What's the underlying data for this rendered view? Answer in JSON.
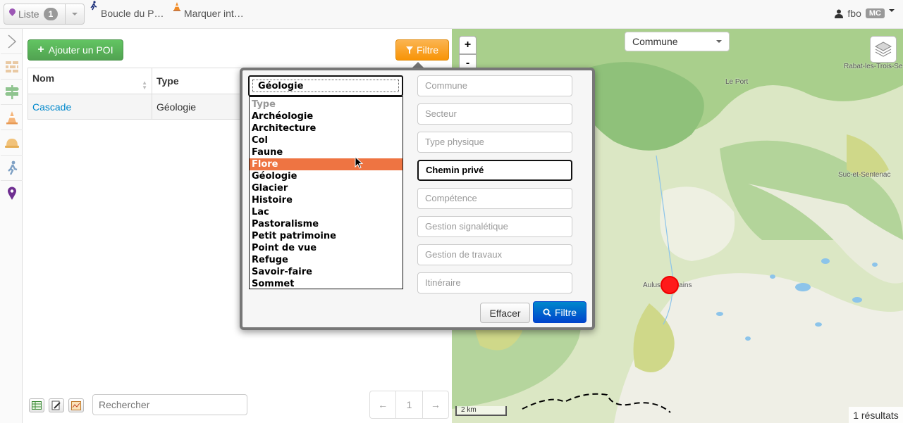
{
  "topbar": {
    "liste_label": "Liste",
    "liste_count": "1",
    "history": [
      {
        "label": "Boucle du P…",
        "icon": "hiker-icon"
      },
      {
        "label": "Marquer int…",
        "icon": "traffic-cone-icon"
      }
    ],
    "user": "fbo",
    "user_badge": "MC"
  },
  "sidebar": {
    "items": [
      "chevron-right-icon",
      "wall-icon",
      "signpost-icon",
      "traffic-cone-icon",
      "hardhat-icon",
      "hiker-icon",
      "map-pin-icon"
    ],
    "active_color": "#6f2f91"
  },
  "list": {
    "add_button": "Ajouter un POI",
    "filter_button": "Filtre",
    "columns": [
      "Nom",
      "Type"
    ],
    "rows": [
      {
        "nom": "Cascade",
        "type": "Géologie"
      }
    ],
    "search_placeholder": "Rechercher",
    "pager": {
      "prev": "←",
      "page": "1",
      "next": "→"
    }
  },
  "filter": {
    "type_selected": "Géologie",
    "type_options": [
      "Type",
      "Archéologie",
      "Architecture",
      "Col",
      "Faune",
      "Flore",
      "Géologie",
      "Glacier",
      "Histoire",
      "Lac",
      "Pastoralisme",
      "Petit patrimoine",
      "Point de vue",
      "Refuge",
      "Savoir-faire",
      "Sommet"
    ],
    "highlighted": "Flore",
    "fields": [
      {
        "placeholder": "Commune",
        "value": ""
      },
      {
        "placeholder": "Secteur",
        "value": ""
      },
      {
        "placeholder": "Type physique",
        "value": ""
      },
      {
        "placeholder": "",
        "value": "Chemin privé"
      },
      {
        "placeholder": "Compétence",
        "value": ""
      },
      {
        "placeholder": "Gestion signalétique",
        "value": ""
      },
      {
        "placeholder": "Gestion de travaux",
        "value": ""
      },
      {
        "placeholder": "Itinéraire",
        "value": ""
      }
    ],
    "clear_button": "Effacer",
    "apply_button": "Filtre"
  },
  "map": {
    "zoom_in": "+",
    "zoom_out": "-",
    "commune_select": "Commune",
    "labels": [
      "Rabat-les-Trois-Se",
      "Le Port",
      "Suc-et-Sentenac",
      "Aulus-les-Bains"
    ],
    "scale": "2 km",
    "results": "1 résultats"
  },
  "colors": {
    "green": "#51a351",
    "orange": "#f89406",
    "blue": "#0055cc",
    "highlight": "#ee7442",
    "marker": "#ff1a1a"
  }
}
